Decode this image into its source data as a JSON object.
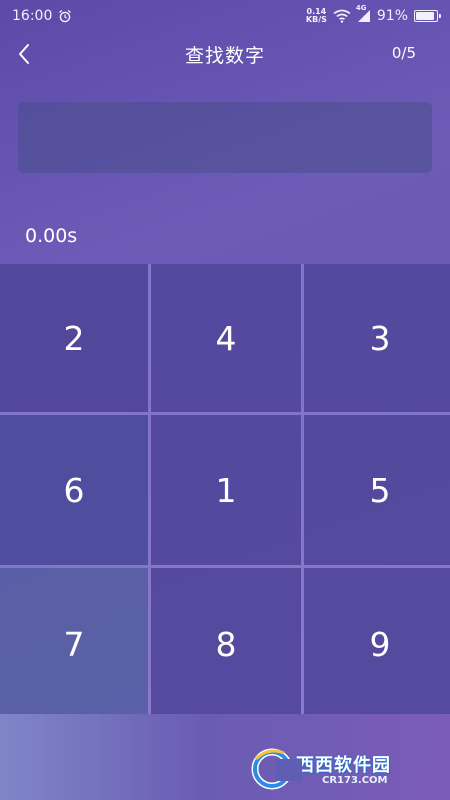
{
  "status_bar": {
    "time": "16:00",
    "net_speed_value": "0.14",
    "net_speed_unit": "KB/S",
    "network_type": "4G",
    "battery_text": "91%",
    "battery_level": 0.91
  },
  "header": {
    "title": "查找数字",
    "progress": "0/5"
  },
  "timer": "0.00s",
  "grid": {
    "cells": [
      "2",
      "4",
      "3",
      "6",
      "1",
      "5",
      "7",
      "8",
      "9"
    ]
  },
  "watermark": {
    "main": "西西软件园",
    "sub": "CR173.COM"
  },
  "colors": {
    "background_start": "#5b4aa8",
    "background_end": "#8a6bc2",
    "cell": "#4c4296",
    "grid_line": "#968cdc"
  }
}
